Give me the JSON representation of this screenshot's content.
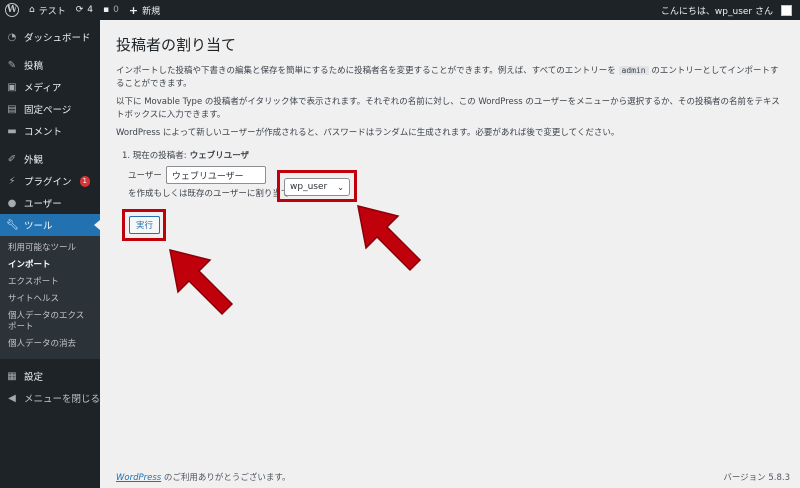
{
  "adminbar": {
    "site_name": "テスト",
    "updates_count": "4",
    "comments_count": "0",
    "new_label": "新規",
    "greeting": "こんにちは、wp_user さん"
  },
  "sidebar": {
    "items": [
      {
        "icon": "dashboard-icon",
        "label": "ダッシュボード"
      },
      {
        "icon": "pin-icon",
        "label": "投稿"
      },
      {
        "icon": "media-icon",
        "label": "メディア"
      },
      {
        "icon": "page-icon",
        "label": "固定ページ"
      },
      {
        "icon": "comment-icon",
        "label": "コメント"
      },
      {
        "icon": "brush-icon",
        "label": "外観"
      },
      {
        "icon": "plugin-icon",
        "label": "プラグイン",
        "badge": "1"
      },
      {
        "icon": "user-icon",
        "label": "ユーザー"
      },
      {
        "icon": "wrench-icon",
        "label": "ツール"
      },
      {
        "icon": "settings-icon",
        "label": "設定"
      },
      {
        "icon": "collapse-icon",
        "label": "メニューを閉じる"
      }
    ],
    "submenu": [
      "利用可能なツール",
      "インポート",
      "エクスポート",
      "サイトヘルス",
      "個人データのエクスポート",
      "個人データの消去"
    ]
  },
  "main": {
    "title": "投稿者の割り当て",
    "para1_a": "インポートした投稿や下書きの編集と保存を簡単にするために投稿者名を変更することができます。例えば、すべてのエントリーを",
    "para1_code": "admin",
    "para1_b": "のエントリーとしてインポートすることができます。",
    "para2": "以下に Movable Type の投稿者がイタリック体で表示されます。それぞれの名前に対し、この WordPress のユーザーをメニューから選択するか、その投稿者の名前をテキストボックスに入力できます。",
    "para3": "WordPress によって新しいユーザーが作成されると、パスワードはランダムに生成されます。必要があれば後で変更してください。",
    "current_author_label": "1. 現在の投稿者:",
    "current_author_name": "ウェブリユーザ",
    "user_label": "ユーザー",
    "user_value": "ウェブリユーザー",
    "assign_label": "を作成もしくは既存のユーザーに割り当て:",
    "select_value": "wp_user",
    "submit_label": "実行"
  },
  "footer": {
    "link": "WordPress",
    "thanks": "のご利用ありがとうございます。",
    "version": "バージョン 5.8.3"
  },
  "colors": {
    "accent": "#2271b1",
    "annotation": "#c0000b",
    "sidebar_bg": "#1d2327"
  }
}
